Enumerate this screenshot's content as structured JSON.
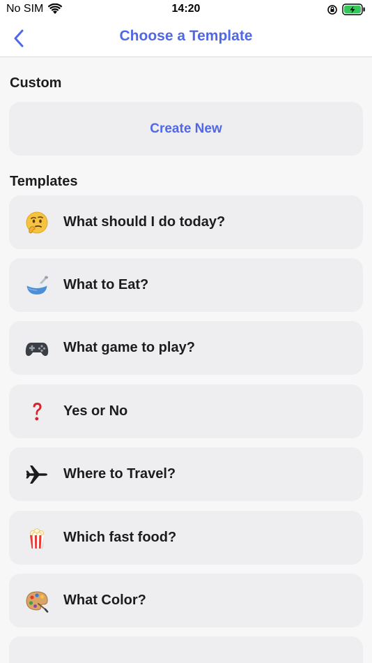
{
  "status_bar": {
    "carrier": "No SIM",
    "time": "14:20"
  },
  "nav": {
    "title": "Choose a Template"
  },
  "custom_section": {
    "header": "Custom",
    "create_label": "Create New"
  },
  "templates_section": {
    "header": "Templates",
    "items": [
      {
        "label": "What should I do today?",
        "icon": "thinking-face-icon"
      },
      {
        "label": "What to Eat?",
        "icon": "bowl-icon"
      },
      {
        "label": "What game to play?",
        "icon": "game-controller-icon"
      },
      {
        "label": "Yes or No",
        "icon": "question-mark-icon"
      },
      {
        "label": "Where to Travel?",
        "icon": "airplane-icon"
      },
      {
        "label": "Which fast food?",
        "icon": "popcorn-icon"
      },
      {
        "label": "What Color?",
        "icon": "palette-icon"
      }
    ]
  },
  "colors": {
    "accent": "#5168e6",
    "card_background": "#eeeef1",
    "page_background": "#f7f7f7"
  }
}
